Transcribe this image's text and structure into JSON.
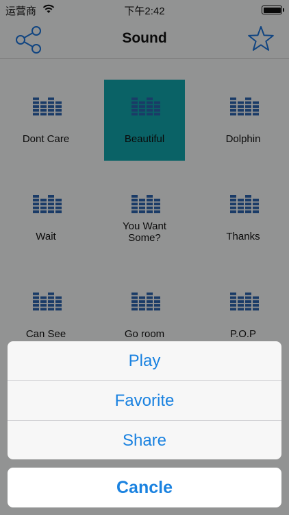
{
  "status_bar": {
    "carrier": "运营商",
    "time": "下午2:42"
  },
  "nav": {
    "title": "Sound",
    "share_icon": "share-icon",
    "star_icon": "star-icon"
  },
  "colors": {
    "accent": "#1a82e0",
    "selected_cell": "#119fa5",
    "equalizer": "#2a5fa6"
  },
  "sounds": [
    {
      "label": "Dont Care",
      "selected": false
    },
    {
      "label": "Beautiful",
      "selected": true
    },
    {
      "label": "Dolphin",
      "selected": false
    },
    {
      "label": "Wait",
      "selected": false
    },
    {
      "label": "You Want Some?",
      "selected": false
    },
    {
      "label": "Thanks",
      "selected": false
    },
    {
      "label": "Can See",
      "selected": false
    },
    {
      "label": "Go room",
      "selected": false
    },
    {
      "label": "P.O.P",
      "selected": false
    }
  ],
  "action_sheet": {
    "items": [
      "Play",
      "Favorite",
      "Share"
    ],
    "cancel": "Cancle"
  }
}
